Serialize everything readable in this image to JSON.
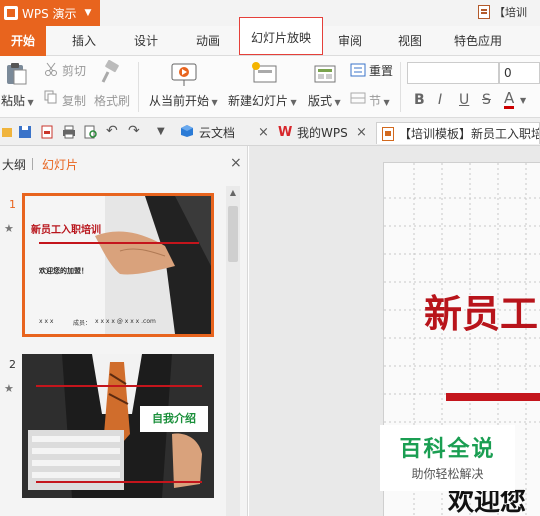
{
  "titlebar": {
    "app_name": "WPS 演示",
    "doc_title": "【培训"
  },
  "ribbon_tabs": [
    "开始",
    "插入",
    "设计",
    "动画",
    "幻灯片放映",
    "审阅",
    "视图",
    "特色应用"
  ],
  "ribbon": {
    "paste": "粘贴",
    "cut": "剪切",
    "copy": "复制",
    "format_painter": "格式刷",
    "from_current": "从当前开始",
    "new_slide": "新建幻灯片",
    "layout": "版式",
    "reset": "重置",
    "section": "节",
    "font_size": "0",
    "bold": "B",
    "italic": "I",
    "underline": "U",
    "strike": "S",
    "font_color": "A"
  },
  "quickbar": {
    "tabs": [
      "云文档",
      "我的WPS",
      "【培训模板】新员工入职培"
    ]
  },
  "left_panel": {
    "tab_outline": "大纲",
    "tab_slides": "幻灯片",
    "close": "×",
    "slides": [
      {
        "number": "1",
        "title": "新员工入职培训",
        "subtitle": "欢迎您的加盟！",
        "footer_left": "x  x  x",
        "footer_mid": "成员：",
        "footer_right": "x x x x @ x x x .com"
      },
      {
        "number": "2",
        "label": "自我介绍"
      }
    ]
  },
  "main_slide": {
    "title": "新员工",
    "welcome": "欢迎您"
  },
  "watermark": {
    "main": "百科全说",
    "sub": "助你轻松解决"
  },
  "colors": {
    "accent": "#e8641e",
    "slide_red": "#b8141b",
    "watermark_green": "#1a9e52"
  }
}
